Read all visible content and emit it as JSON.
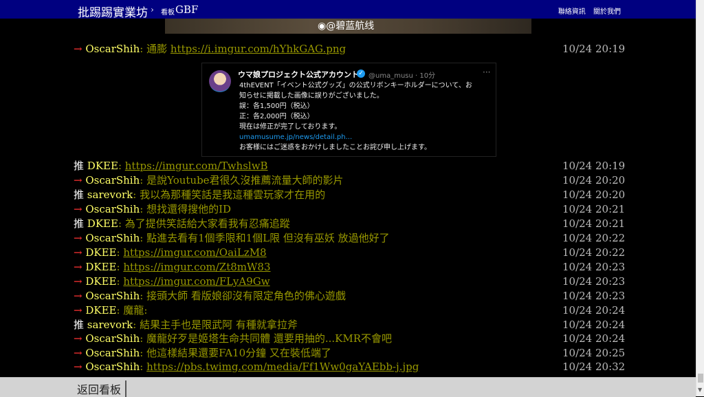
{
  "header": {
    "site_title": "批踢踢實業坊",
    "separator": "›",
    "board_label": "看板",
    "board_name": "GBF",
    "links": [
      "聯絡資訊",
      "關於我們"
    ]
  },
  "image_watermark": "@碧蓝航线",
  "tweet": {
    "account_name": "ウマ娘プロジェクト公式アカウント",
    "verified_icon": "check-badge-icon",
    "handle_time": "@uma_musu · 10分",
    "more": "···",
    "lines": [
      "4thEVENT「イベント公式グッズ」の公式リボンキーホルダーについて、お",
      "知らせに掲載した画像に誤りがございました。",
      "誤：各1,500円（税込）",
      "正：各2,000円（税込）",
      "現在は修正が完了しております。",
      "umamusume.jp/news/detail.ph...",
      "お客様にはご迷惑をおかけしましたことお詫び申し上げます。"
    ]
  },
  "comments": [
    {
      "tag": "→",
      "user": "OscarShih",
      "content": "通膨 ",
      "link": "https://i.imgur.com/hYhkGAG.png",
      "time": "10/24 20:19"
    },
    {
      "tag": "推",
      "user": "DKEE",
      "content": "",
      "link": "https://imgur.com/TwhslwB",
      "time": "10/24 20:19"
    },
    {
      "tag": "→",
      "user": "OscarShih",
      "content": "是說Youtube君很久沒推薦流量大師的影片",
      "link": "",
      "time": "10/24 20:20"
    },
    {
      "tag": "推",
      "user": "sarevork",
      "content": "我以為那種笑話是我這種雲玩家才在用的",
      "link": "",
      "time": "10/24 20:20"
    },
    {
      "tag": "→",
      "user": "OscarShih",
      "content": "想找還得搜他的ID",
      "link": "",
      "time": "10/24 20:21"
    },
    {
      "tag": "推",
      "user": "DKEE",
      "content": "為了提供笑話給大家看我有忍痛追蹤",
      "link": "",
      "time": "10/24 20:21"
    },
    {
      "tag": "→",
      "user": "OscarShih",
      "content": "點進去看有1個季限和1個L限 但沒有巫妖 放過他好了",
      "link": "",
      "time": "10/24 20:22"
    },
    {
      "tag": "→",
      "user": "DKEE",
      "content": "",
      "link": "https://imgur.com/OaiLzM8",
      "time": "10/24 20:22"
    },
    {
      "tag": "→",
      "user": "DKEE",
      "content": "",
      "link": "https://imgur.com/Zt8mW83",
      "time": "10/24 20:23"
    },
    {
      "tag": "→",
      "user": "DKEE",
      "content": "",
      "link": "https://imgur.com/FLyA9Gw",
      "time": "10/24 20:23"
    },
    {
      "tag": "→",
      "user": "OscarShih",
      "content": "接頭大師 看版娘卻沒有限定角色的佛心遊戲",
      "link": "",
      "time": "10/24 20:23"
    },
    {
      "tag": "→",
      "user": "DKEE",
      "content": "魔龍:",
      "link": "",
      "time": "10/24 20:24"
    },
    {
      "tag": "推",
      "user": "sarevork",
      "content": "結果主手也是限武阿 有種就拿拉斧",
      "link": "",
      "time": "10/24 20:24"
    },
    {
      "tag": "→",
      "user": "OscarShih",
      "content": "魔龍好歹是姬塔生命共同體 還要用抽的...KMR不會吧",
      "link": "",
      "time": "10/24 20:24"
    },
    {
      "tag": "→",
      "user": "OscarShih",
      "content": "他這樣結果還要FA10分鐘 又在裝低端了",
      "link": "",
      "time": "10/24 20:25"
    },
    {
      "tag": "→",
      "user": "OscarShih",
      "content": "",
      "link": "https://pbs.twimg.com/media/Ff1Ww0gaYAEbb-j.jpg",
      "time": "10/24 20:32"
    }
  ],
  "footer": {
    "back_label": "返回看板"
  }
}
